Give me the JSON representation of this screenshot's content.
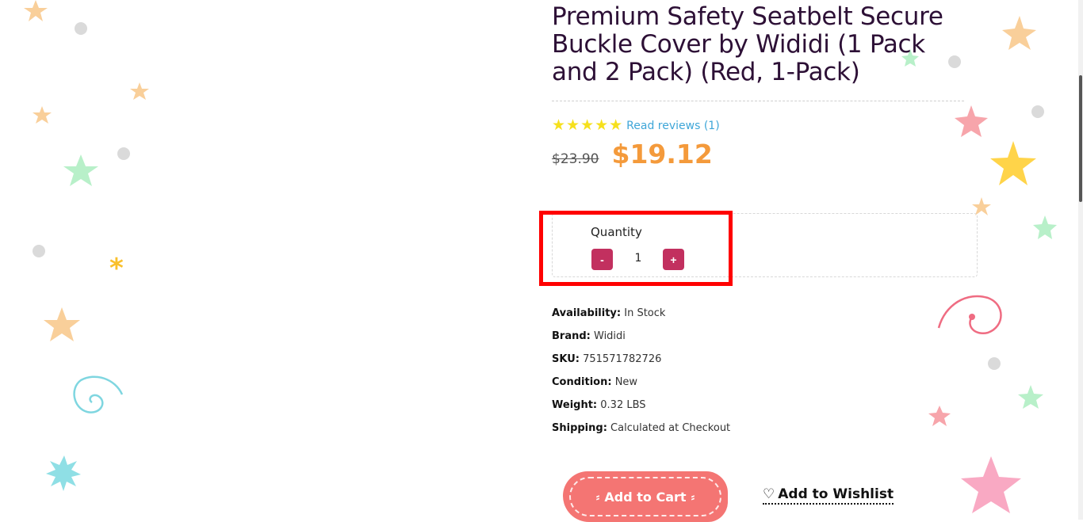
{
  "product": {
    "title": "Premium Safety Seatbelt Secure Buckle Cover by Wididi (1 Pack and 2 Pack) (Red, 1-Pack)",
    "rating_stars": "★★★★★",
    "rating_value": 5,
    "reviews_link": "Read reviews (1)",
    "old_price": "$23.90",
    "price": "$19.12"
  },
  "quantity": {
    "label": "Quantity",
    "minus": "-",
    "plus": "+",
    "value": "1"
  },
  "specs": [
    {
      "key": "Availability:",
      "value": "In Stock"
    },
    {
      "key": "Brand:",
      "value": "Wididi"
    },
    {
      "key": "SKU:",
      "value": "751571782726"
    },
    {
      "key": "Condition:",
      "value": "New"
    },
    {
      "key": "Weight:",
      "value": "0.32 LBS"
    },
    {
      "key": "Shipping:",
      "value": "Calculated at Checkout"
    }
  ],
  "actions": {
    "add_to_cart": "Add to Cart",
    "wishlist": "Add to Wishlist",
    "wishlist_icon": "♡"
  },
  "colors": {
    "title": "#2d1036",
    "price": "#f49a3b",
    "link": "#3ea6d8",
    "qty_button": "#c2305f",
    "cart_button": "#f47573",
    "highlight": "#ff0000"
  }
}
